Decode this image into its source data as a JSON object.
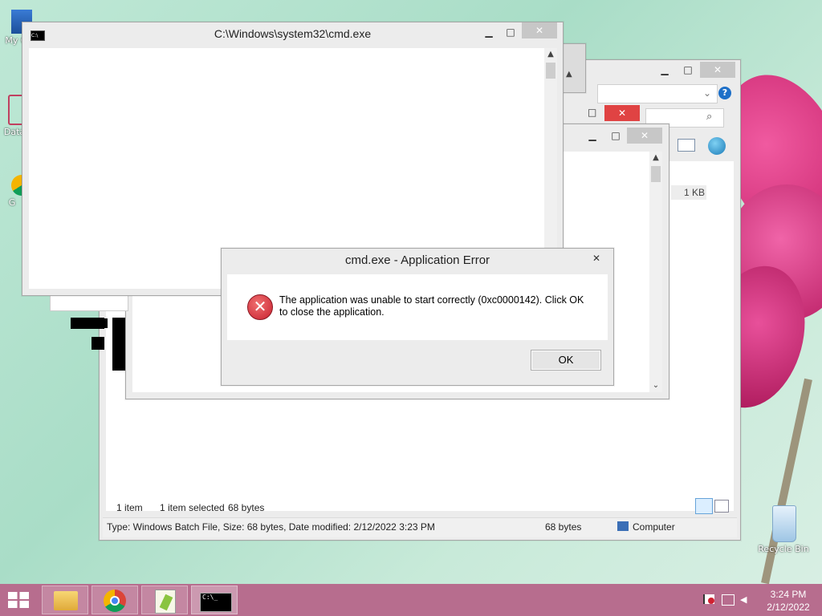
{
  "desktop": {
    "icons": [
      {
        "label": "My C"
      },
      {
        "label": "Data"
      },
      {
        "label": "G"
      },
      {
        "label": "Recycle Bin"
      }
    ]
  },
  "cmd_window": {
    "title": "C:\\Windows\\system32\\cmd.exe",
    "minimize": "▁",
    "maximize": "□",
    "close": "✕"
  },
  "explorer_window": {
    "minimize": "▁",
    "maximize": "□",
    "close": "✕",
    "file_size_cell": "1 KB",
    "status_items": "1 item",
    "status_selected": "1 item selected",
    "status_selected_size": "68 bytes",
    "details_bar": "Type: Windows Batch File, Size: 68 bytes, Date modified: 2/12/2022 3:23 PM",
    "details_size": "68 bytes",
    "details_location": "Computer"
  },
  "notepad_window": {
    "minimize": "▁",
    "maximize": "□",
    "close": "✕"
  },
  "error_dialog": {
    "title": "cmd.exe - Application Error",
    "message": "The application was unable to start correctly (0xc0000142). Click OK to close the application.",
    "ok_label": "OK",
    "close": "✕"
  },
  "taskbar": {
    "time": "3:24 PM",
    "date": "2/12/2022"
  },
  "colors": {
    "taskbar": "#b76d8e",
    "error_icon": "#c8202f",
    "close_red": "#e04343"
  }
}
